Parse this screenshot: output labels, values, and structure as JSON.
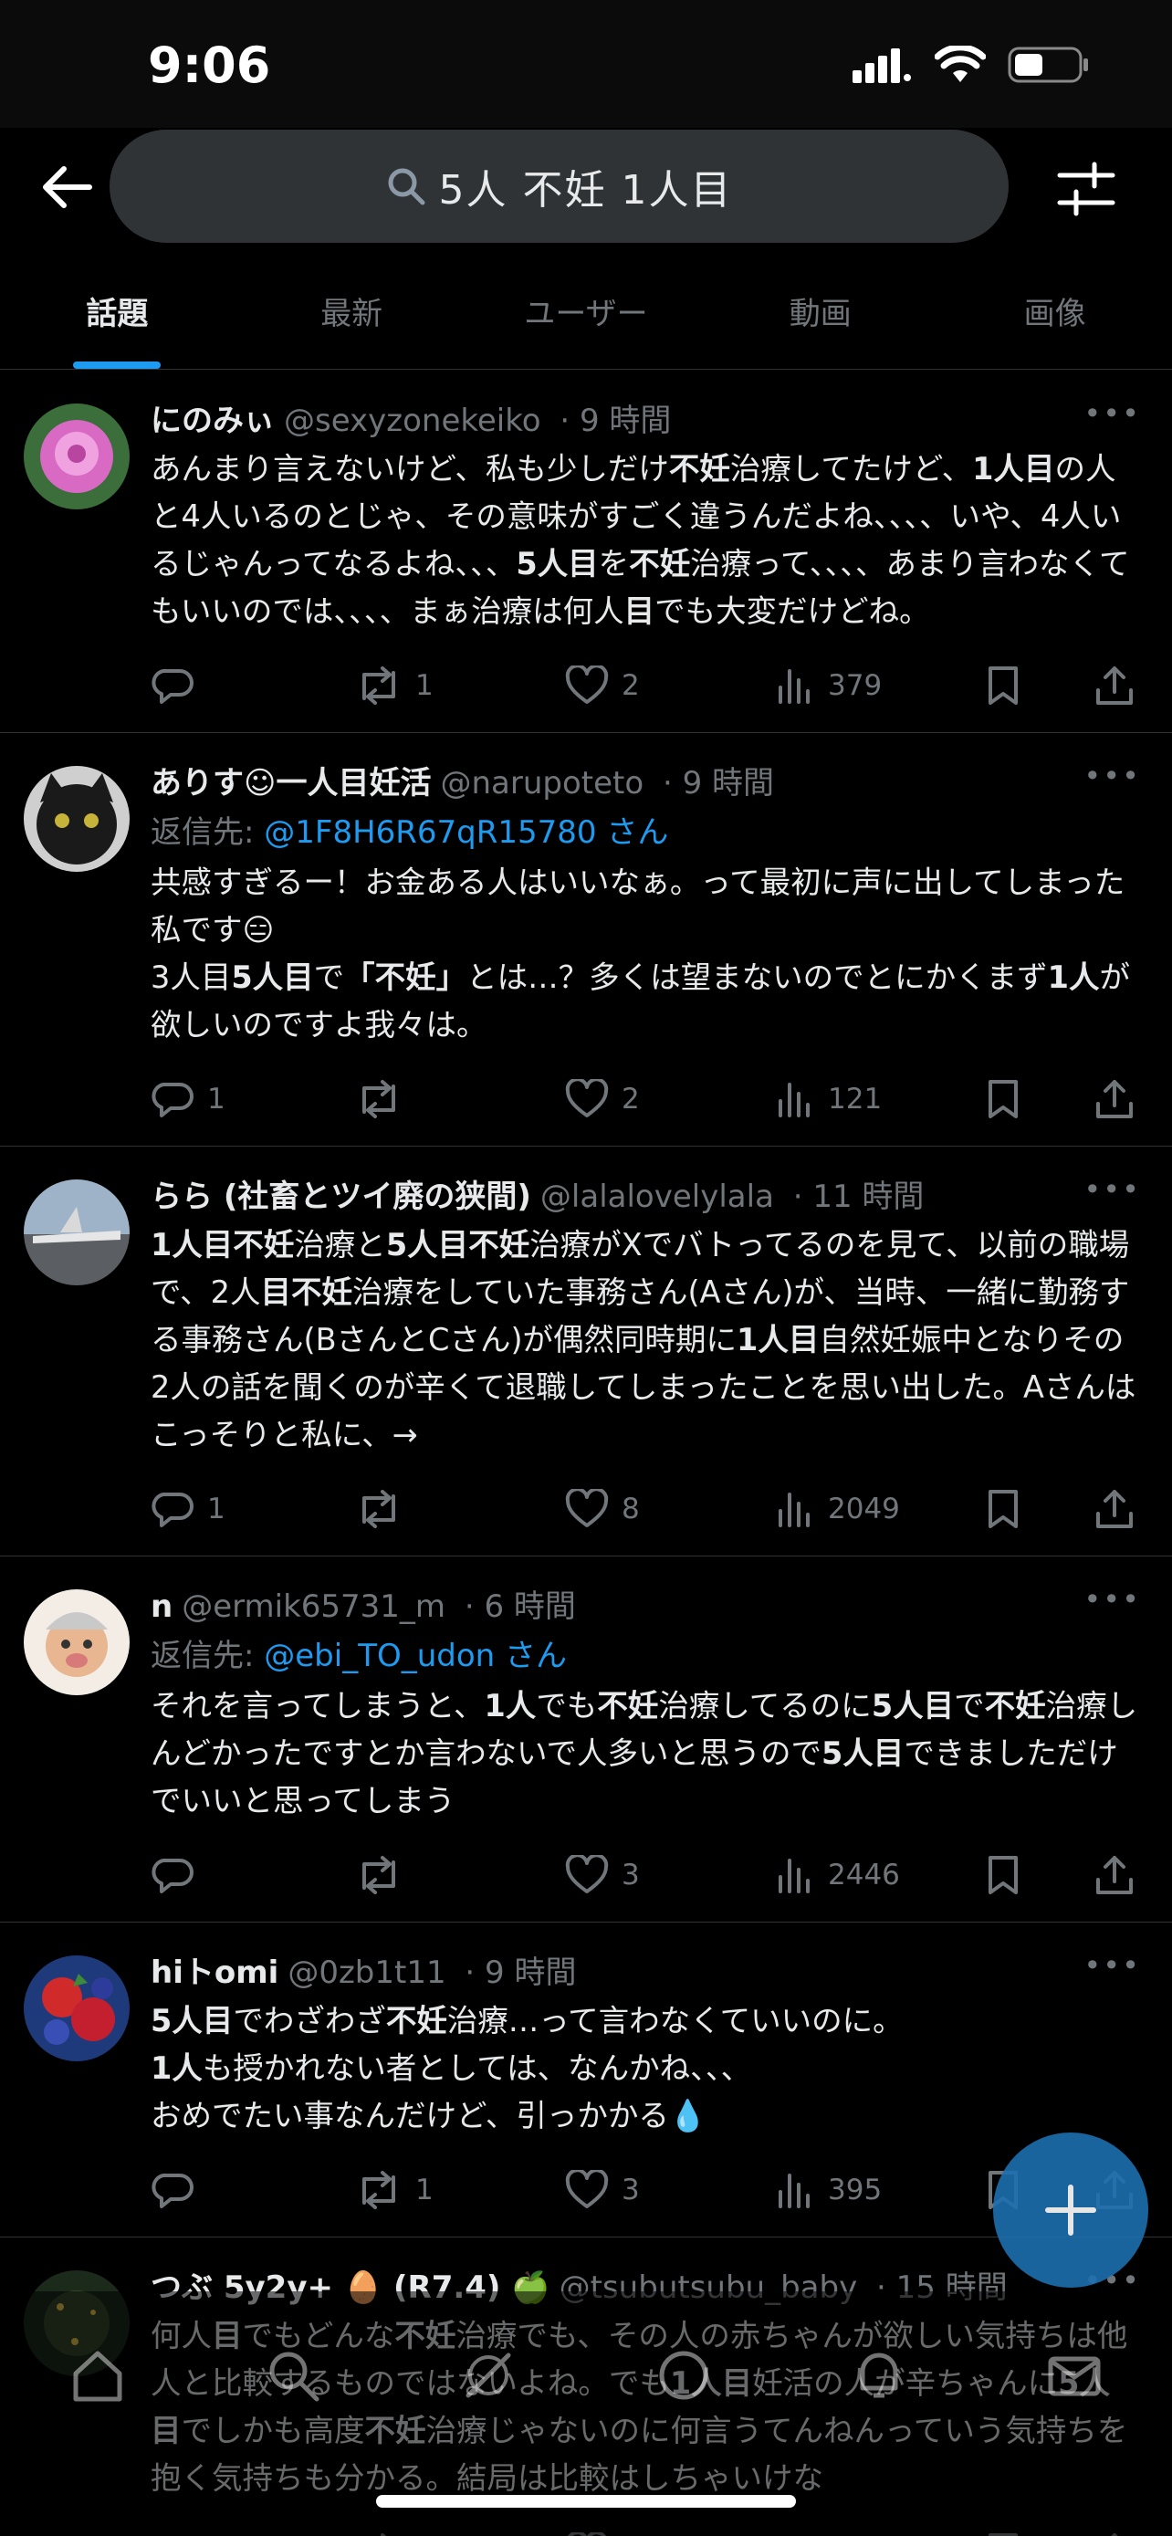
{
  "status_bar": {
    "time": "9:06"
  },
  "search": {
    "query": "5人 不妊 1人目"
  },
  "tabs": [
    {
      "label": "話題",
      "active": true
    },
    {
      "label": "最新",
      "active": false
    },
    {
      "label": "ユーザー",
      "active": false
    },
    {
      "label": "動画",
      "active": false
    },
    {
      "label": "画像",
      "active": false
    }
  ],
  "posts": [
    {
      "name": "にのみぃ",
      "handle": "@sexyzonekeiko",
      "time": "· 9 時間",
      "reply_prefix": "",
      "reply_to": "",
      "reply_suffix": "",
      "body_html": "あんまり言えないけど、私も少しだけ<b>不妊</b>治療してたけど、<b>1人目</b>の人と4人いるのとじゃ、その意味がすごく違うんだよね、、、、いや、4人いるじゃんってなるよね、、、<b>5人目</b>を<b>不妊</b>治療って、、、、あまり言わなくてもいいのでは、、、、まぁ治療は何人<b>目</b>でも大変だけどね。",
      "replies": "",
      "reposts": "1",
      "likes": "2",
      "views": "379"
    },
    {
      "name": "ありす☺︎一人目妊活",
      "handle": "@narupoteto",
      "time": "· 9 時間",
      "reply_prefix": "返信先: ",
      "reply_to": "@1F8H6R67qR15780 さん",
      "reply_suffix": "",
      "body_html": "共感すぎるー！お金ある人はいいなぁ。って最初に声に出してしまった私です😑<br>3人目<b>5人目</b>で<b>「不妊」</b>とは…？多くは望まないのでとにかくまず<b>1人</b>が欲しいのですよ我々は。",
      "replies": "1",
      "reposts": "",
      "likes": "2",
      "views": "121"
    },
    {
      "name": "らら (社畜とツイ廃の狭間)",
      "handle": "@lalalovelylala",
      "time": "· 11 時間",
      "reply_prefix": "",
      "reply_to": "",
      "reply_suffix": "",
      "body_html": "<b>1人目不妊</b>治療と<b>5人目不妊</b>治療がXでバトってるのを見て、以前の職場で、2人<b>目不妊</b>治療をしていた事務さん(Aさん)が、当時、一緒に勤務する事務さん(BさんとCさん)が偶然同時期に<b>1人目</b>自然妊娠中となりその2人の話を聞くのが辛くて退職してしまったことを思い出した。Aさんはこっそりと私に、→",
      "replies": "1",
      "reposts": "",
      "likes": "8",
      "views": "2049"
    },
    {
      "name": "n",
      "handle": "@ermik65731_m",
      "time": "· 6 時間",
      "reply_prefix": "返信先: ",
      "reply_to": "@ebi_TO_udon さん",
      "reply_suffix": "",
      "body_html": "それを言ってしまうと、<b>1人</b>でも<b>不妊</b>治療してるのに<b>5人目</b>で<b>不妊</b>治療しんどかったですとか言わないで人多いと思うので<b>5人目</b>できましただけでいいと思ってしまう",
      "replies": "",
      "reposts": "",
      "likes": "3",
      "views": "2446"
    },
    {
      "name": "hiトomi",
      "handle": "@0zb1t11",
      "time": "· 9 時間",
      "reply_prefix": "",
      "reply_to": "",
      "reply_suffix": "",
      "body_html": "<b>5人目</b>でわざわざ<b>不妊</b>治療…って言わなくていいのに。<br><b>1人</b>も授かれない者としては、なんかね、、、<br>おめでたい事なんだけど、引っかかる💧",
      "replies": "",
      "reposts": "1",
      "likes": "3",
      "views": "395"
    },
    {
      "name": "つぶ 5y2y+ 🥚 (R7.4) 🍏",
      "handle": "@tsubutsubu_baby",
      "time": "· 15 時間",
      "reply_prefix": "",
      "reply_to": "",
      "reply_suffix": "",
      "body_html": "何人<b>目</b>でもどんな<b>不妊</b>治療でも、その人の赤ちゃんが欲しい気持ちは他人と比較するものではないよね。でも<b>1人目</b>妊活の人が辛ちゃんに<b>5人目</b>でしかも高度<b>不妊</b>治療じゃないのに何言うてんねんっていう気持ちを抱く気持ちも分かる。結局は比較はしちゃいけな",
      "replies": "",
      "reposts": "",
      "likes": "",
      "views": ""
    }
  ],
  "colors": {
    "accent": "#1d9bf0",
    "muted": "#71767b",
    "text": "#e7e9ea",
    "background": "#000000",
    "divider": "#2f3336"
  }
}
